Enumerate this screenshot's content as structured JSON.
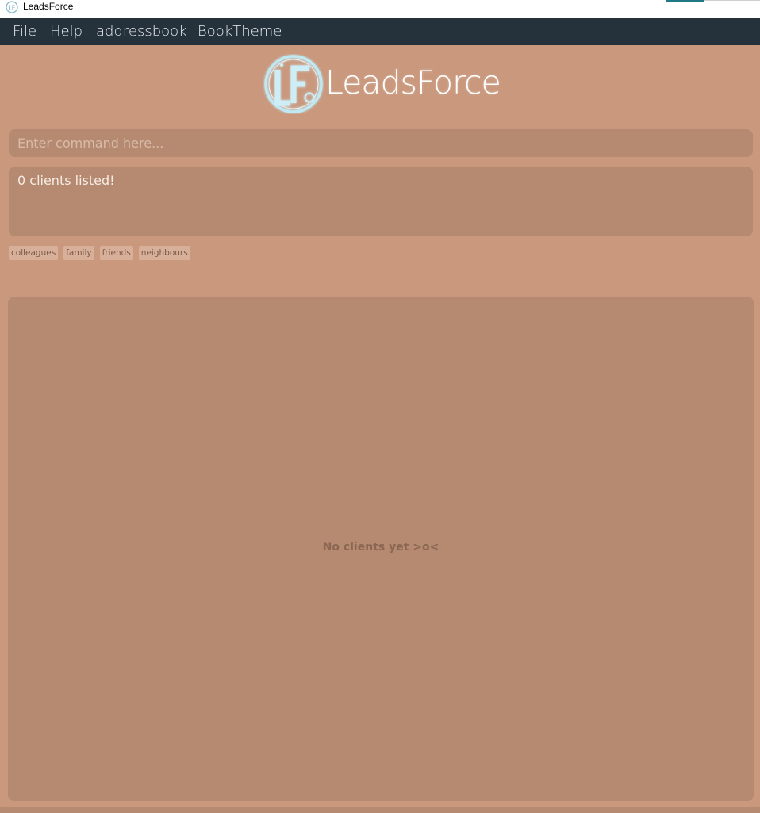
{
  "window": {
    "title": "LeadsForce"
  },
  "menu": {
    "items": [
      "File",
      "Help",
      "addressbook",
      "BookTheme"
    ]
  },
  "header": {
    "brand": "LeadsForce",
    "logo_text": "LF"
  },
  "command": {
    "placeholder": "Enter command here...",
    "value": ""
  },
  "result": {
    "text": "0 clients listed!"
  },
  "tags": [
    "colleagues",
    "family",
    "friends",
    "neighbours"
  ],
  "client_list": {
    "empty_message": "No clients yet >o<"
  },
  "colors": {
    "background": "#c9987d",
    "panel": "#b58a70",
    "menubar": "#25313b",
    "logo_glow": "#bfe8f2"
  }
}
